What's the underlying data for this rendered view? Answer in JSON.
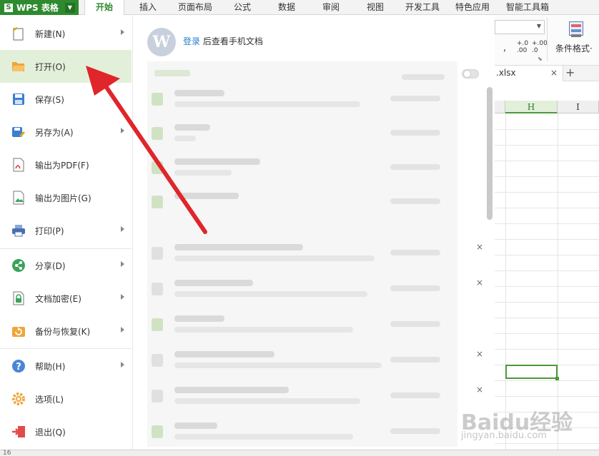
{
  "app": {
    "title": "WPS 表格",
    "logo_glyph": "S"
  },
  "tabs": [
    {
      "label": "开始",
      "active": true
    },
    {
      "label": "插入"
    },
    {
      "label": "页面布局"
    },
    {
      "label": "公式"
    },
    {
      "label": "数据"
    },
    {
      "label": "审阅"
    },
    {
      "label": "视图"
    },
    {
      "label": "开发工具"
    },
    {
      "label": "特色应用"
    },
    {
      "label": "智能工具箱"
    }
  ],
  "ribbon": {
    "number_format_1": ".00",
    "number_format_2": "+.0",
    "number_format_3": ".0",
    "number_format_4": "+.00",
    "comma": ",",
    "conditional_format": "条件格式·"
  },
  "doc_tab": {
    "name": ".xlsx",
    "close": "×",
    "add": "+"
  },
  "sheet": {
    "col_h": "H",
    "col_i": "I",
    "row_number": "16"
  },
  "menu": [
    {
      "label": "新建(N)",
      "icon": "new-icon",
      "arrow": true
    },
    {
      "label": "打开(O)",
      "icon": "open-folder-icon",
      "arrow": false,
      "highlight": true
    },
    {
      "label": "保存(S)",
      "icon": "save-icon",
      "arrow": false
    },
    {
      "label": "另存为(A)",
      "icon": "save-as-icon",
      "arrow": true
    },
    {
      "label": "输出为PDF(F)",
      "icon": "pdf-icon",
      "arrow": false
    },
    {
      "label": "输出为图片(G)",
      "icon": "image-export-icon",
      "arrow": false
    },
    {
      "label": "打印(P)",
      "icon": "printer-icon",
      "arrow": true
    },
    {
      "label": "分享(D)",
      "icon": "share-icon",
      "arrow": true
    },
    {
      "label": "文档加密(E)",
      "icon": "lock-icon",
      "arrow": true
    },
    {
      "label": "备份与恢复(K)",
      "icon": "backup-icon",
      "arrow": true
    },
    {
      "label": "帮助(H)",
      "icon": "help-icon",
      "arrow": true
    },
    {
      "label": "选项(L)",
      "icon": "gear-icon",
      "arrow": false
    },
    {
      "label": "退出(Q)",
      "icon": "exit-icon",
      "arrow": false
    }
  ],
  "panel": {
    "avatar_glyph": "W",
    "login_link": "登录",
    "login_text": " 后查看手机文档",
    "close_glyph": "×"
  },
  "watermark": {
    "main": "Baidu经验",
    "sub": "jingyan.baidu.com"
  },
  "colors": {
    "accent": "#2f8a2f",
    "highlight": "#e3f0d9",
    "arrow": "#e0252b",
    "link": "#2a7fd0"
  }
}
